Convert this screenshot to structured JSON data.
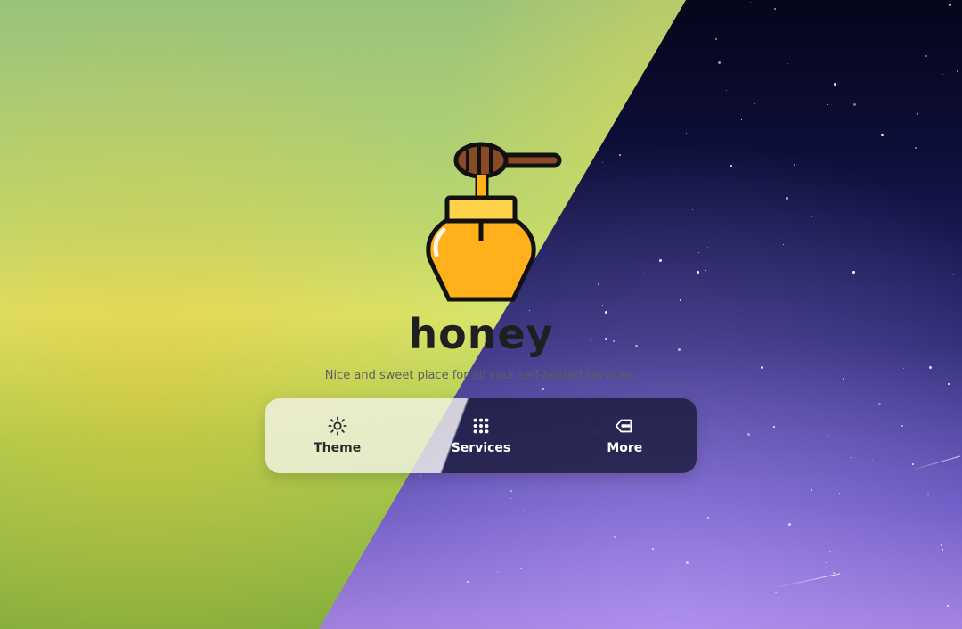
{
  "app": {
    "title": "honey",
    "tagline": "Nice and sweet place for all your self-hosted services."
  },
  "menu": {
    "items": [
      {
        "label": "Theme",
        "icon": "sun-icon"
      },
      {
        "label": "Services",
        "icon": "grid-icon"
      },
      {
        "label": "More",
        "icon": "tag-icon"
      }
    ]
  },
  "colors": {
    "honey": "#ffb01a",
    "honey_light": "#ffd24a",
    "outline": "#111111",
    "dipper": "#8a4a26"
  }
}
